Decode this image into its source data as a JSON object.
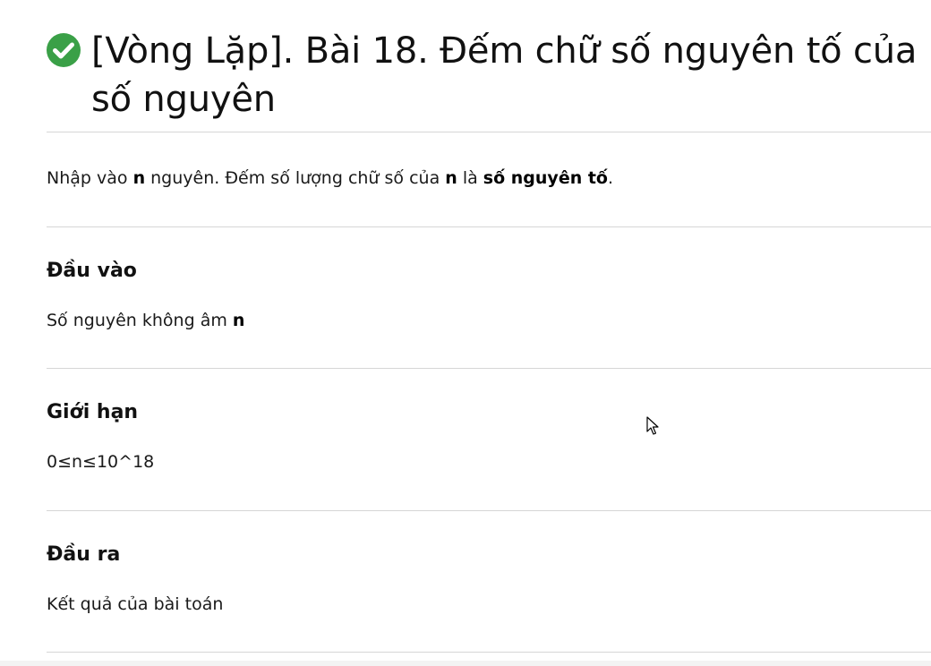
{
  "title": "[Vòng Lặp]. Bài 18. Đếm chữ số nguyên tố của số nguyên",
  "status_icon": "check-circle-icon",
  "status_color": "#3aa047",
  "description": {
    "part1": "Nhập vào ",
    "var1": "n",
    "part2": " nguyên. Đếm số lượng chữ số của ",
    "var2": "n",
    "part3": " là ",
    "emphasis": "số nguyên tố",
    "part4": "."
  },
  "sections": {
    "input": {
      "heading": "Đầu vào",
      "text": "Số nguyên không âm ",
      "var": "n"
    },
    "constraints": {
      "heading": "Giới hạn",
      "text": "0≤n≤10^18"
    },
    "output": {
      "heading": "Đầu ra",
      "text": "Kết quả của bài toán"
    }
  },
  "cursor_icon": "mouse-pointer-icon"
}
